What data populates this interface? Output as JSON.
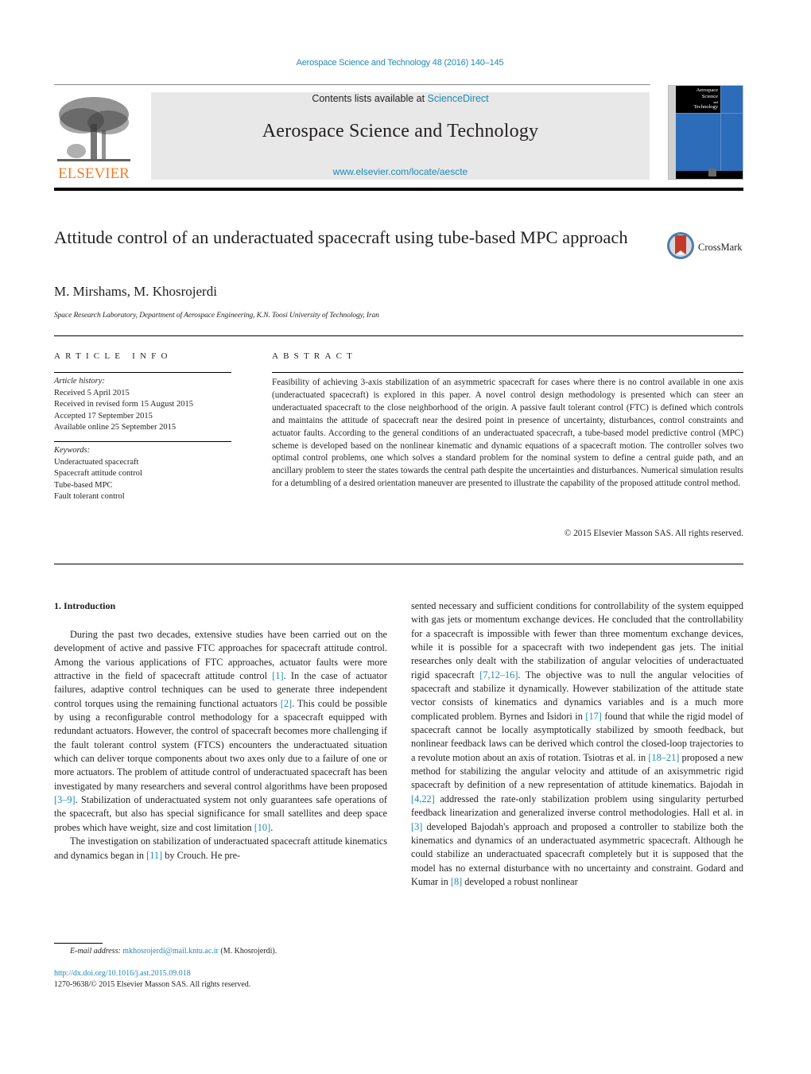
{
  "header": {
    "journal_citation": "Aerospace Science and Technology 48 (2016) 140–145",
    "contents_prefix": "Contents lists available at ",
    "contents_link": "ScienceDirect",
    "journal_title": "Aerospace Science and Technology",
    "journal_url": "www.elsevier.com/locate/aescte",
    "publisher_logo_text": "ELSEVIER",
    "cover_title_lines": [
      "Aerospace",
      "Science",
      "and",
      "Technology"
    ],
    "colors": {
      "link": "#1f8ab6",
      "elsevier_orange": "#f07e26",
      "cover_blue": "#2c6cb9"
    }
  },
  "article": {
    "title": "Attitude control of an underactuated spacecraft using tube-based MPC approach",
    "crossmark_label": "CrossMark",
    "authors": "M. Mirshams, M. Khosrojerdi",
    "affiliation": "Space Research Laboratory, Department of Aerospace Engineering, K.N. Toosi University of Technology, Iran"
  },
  "article_info": {
    "heading": "ARTICLE INFO",
    "history_label": "Article history:",
    "history": [
      "Received 5 April 2015",
      "Received in revised form 15 August 2015",
      "Accepted 17 September 2015",
      "Available online 25 September 2015"
    ],
    "keywords_label": "Keywords:",
    "keywords": [
      "Underactuated spacecraft",
      "Spacecraft attitude control",
      "Tube-based MPC",
      "Fault tolerant control"
    ]
  },
  "abstract": {
    "heading": "ABSTRACT",
    "text": "Feasibility of achieving 3-axis stabilization of an asymmetric spacecraft for cases where there is no control available in one axis (underactuated spacecraft) is explored in this paper. A novel control design methodology is presented which can steer an underactuated spacecraft to the close neighborhood of the origin. A passive fault tolerant control (FTC) is defined which controls and maintains the attitude of spacecraft near the desired point in presence of uncertainty, disturbances, control constraints and actuator faults. According to the general conditions of an underactuated spacecraft, a tube-based model predictive control (MPC) scheme is developed based on the nonlinear kinematic and dynamic equations of a spacecraft motion. The controller solves two optimal control problems, one which solves a standard problem for the nominal system to define a central guide path, and an ancillary problem to steer the states towards the central path despite the uncertainties and disturbances. Numerical simulation results for a detumbling of a desired orientation maneuver are presented to illustrate the capability of the proposed attitude control method.",
    "copyright": "© 2015 Elsevier Masson SAS. All rights reserved."
  },
  "introduction": {
    "heading": "1.  Introduction",
    "left_p1": [
      {
        "t": "During the past two decades, extensive studies have been carried out on the development of active and passive FTC approaches for spacecraft attitude control. Among the various applications of FTC approaches, actuator faults were more attractive in the field of spacecraft attitude control "
      },
      {
        "ref": "[1]"
      },
      {
        "t": ". In the case of actuator failures, adaptive control techniques can be used to generate three independent control torques using the remaining functional actuators "
      },
      {
        "ref": "[2]"
      },
      {
        "t": ". This could be possible by using a reconfigurable control methodology for a spacecraft equipped with redundant actuators. However, the control of spacecraft becomes more challenging if the fault tolerant control system (FTCS) encounters the underactuated situation which can deliver torque components about two axes only due to a failure of one or more actuators. The problem of attitude control of underactuated spacecraft has been investigated by many researchers and several control algorithms have been proposed "
      },
      {
        "ref": "[3–9]"
      },
      {
        "t": ". Stabilization of underactuated system not only guarantees safe operations of the spacecraft, but also has special significance for small satellites and deep space probes which have weight, size and cost limitation "
      },
      {
        "ref": "[10]"
      },
      {
        "t": "."
      }
    ],
    "left_p2": [
      {
        "t": "The investigation on stabilization of underactuated spacecraft attitude kinematics and dynamics began in "
      },
      {
        "ref": "[11]"
      },
      {
        "t": " by Crouch. He pre-"
      }
    ],
    "right_p1": [
      {
        "t": "sented necessary and sufficient conditions for controllability of the system equipped with gas jets or momentum exchange devices. He concluded that the controllability for a spacecraft is impossible with fewer than three momentum exchange devices, while it is possible for a spacecraft with two independent gas jets. The initial researches only dealt with the stabilization of angular velocities of underactuated rigid spacecraft "
      },
      {
        "ref": "[7,12–16]"
      },
      {
        "t": ". The objective was to null the angular velocities of spacecraft and stabilize it dynamically. However stabilization of the attitude state vector consists of kinematics and dynamics variables and is a much more complicated problem. Byrnes and Isidori in "
      },
      {
        "ref": "[17]"
      },
      {
        "t": " found that while the rigid model of spacecraft cannot be locally asymptotically stabilized by smooth feedback, but nonlinear feedback laws can be derived which control the closed-loop trajectories to a revolute motion about an axis of rotation. Tsiotras et al. in "
      },
      {
        "ref": "[18–21]"
      },
      {
        "t": " proposed a new method for stabilizing the angular velocity and attitude of an axisymmetric rigid spacecraft by definition of a new representation of attitude kinematics. Bajodah in "
      },
      {
        "ref": "[4,22]"
      },
      {
        "t": " addressed the rate-only stabilization problem using singularity perturbed feedback linearization and generalized inverse control methodologies. Hall et al. in "
      },
      {
        "ref": "[3]"
      },
      {
        "t": " developed Bajodah's approach and proposed a controller to stabilize both the kinematics and dynamics of an underactuated asymmetric spacecraft. Although he could stabilize an underactuated spacecraft completely but it is supposed that the model has no external disturbance with no uncertainty and constraint. Godard and Kumar in "
      },
      {
        "ref": "[8]"
      },
      {
        "t": " developed a robust nonlinear"
      }
    ]
  },
  "footer": {
    "email_label": "E-mail address:",
    "email": "mkhosrojerdi@mail.kntu.ac.ir",
    "email_owner": " (M. Khosrojerdi).",
    "doi": "http://dx.doi.org/10.1016/j.ast.2015.09.018",
    "issn_copyright": "1270-9638/© 2015 Elsevier Masson SAS. All rights reserved."
  }
}
